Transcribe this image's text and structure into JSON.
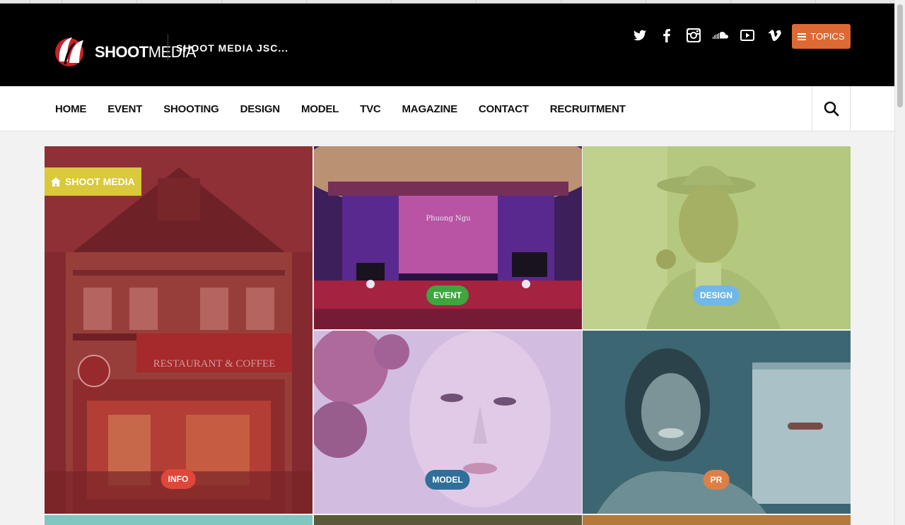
{
  "header": {
    "logo_text_bold": "SHOOT",
    "logo_text_light": "MEDIA",
    "tagline": "SHOOT MEDIA JSC...",
    "socials": [
      "twitter-icon",
      "facebook-icon",
      "instagram-icon",
      "soundcloud-icon",
      "youtube-icon",
      "vimeo-icon"
    ],
    "topics_label": "TOPICS"
  },
  "nav": {
    "items": [
      "HOME",
      "EVENT",
      "SHOOTING",
      "DESIGN",
      "MODEL",
      "TVC",
      "MAGAZINE",
      "CONTACT",
      "RECRUITMENT"
    ]
  },
  "grid": {
    "featured_label": "SHOOT MEDIA",
    "tiles": [
      {
        "badge": "INFO",
        "badge_color": "#e0463a"
      },
      {
        "badge": "EVENT",
        "badge_color": "#3fa53f"
      },
      {
        "badge": "DESIGN",
        "badge_color": "#6fb8e8"
      },
      {
        "badge": "MODEL",
        "badge_color": "#2f6f9a"
      },
      {
        "badge": "PR",
        "badge_color": "#dd7f46"
      }
    ]
  },
  "colors": {
    "accent": "#dd6a34",
    "header_bg": "#000000"
  }
}
